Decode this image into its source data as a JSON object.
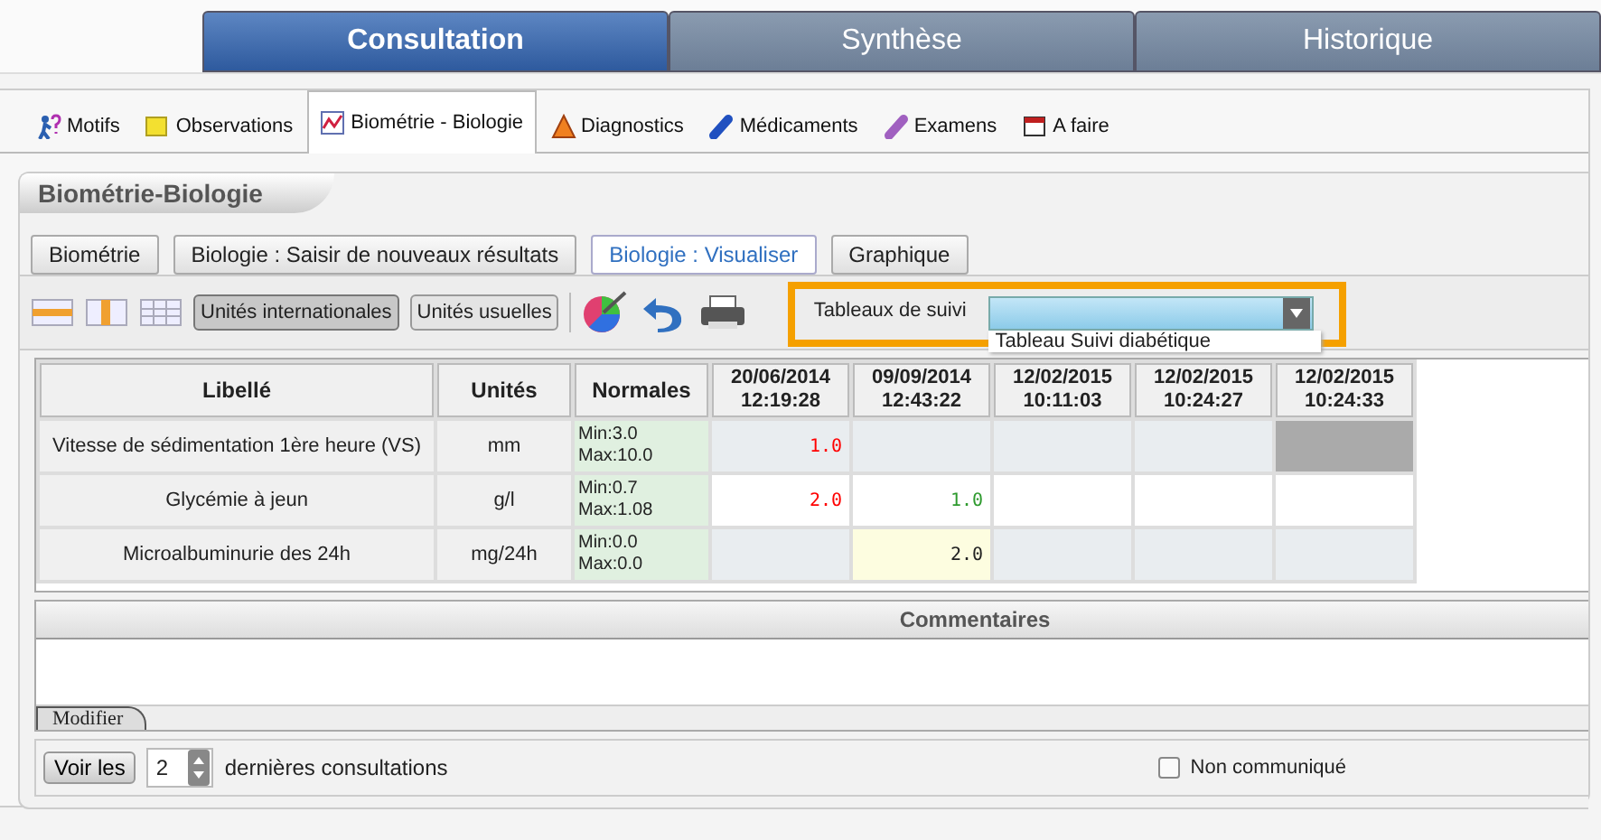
{
  "main_tabs": [
    {
      "label": "Consultation",
      "selected": true
    },
    {
      "label": "Synthèse",
      "selected": false
    },
    {
      "label": "Historique",
      "selected": false
    }
  ],
  "sub_tabs": [
    {
      "label": "Motifs",
      "kind": "walker",
      "selected": false
    },
    {
      "label": "Observations",
      "kind": "note",
      "selected": false
    },
    {
      "label": "Biométrie - Biologie",
      "kind": "chart",
      "selected": true
    },
    {
      "label": "Diagnostics",
      "kind": "warning",
      "selected": false
    },
    {
      "label": "Médicaments",
      "kind": "pill",
      "selected": false
    },
    {
      "label": "Examens",
      "kind": "capsule",
      "selected": false
    },
    {
      "label": "A faire",
      "kind": "calendar",
      "selected": false
    }
  ],
  "panel": {
    "title": "Biométrie-Biologie",
    "view_buttons": [
      {
        "label": "Biométrie",
        "selected": false
      },
      {
        "label": "Biologie : Saisir de nouveaux résultats",
        "selected": false
      },
      {
        "label": "Biologie : Visualiser",
        "selected": true
      },
      {
        "label": "Graphique",
        "selected": false
      }
    ],
    "unit_buttons": [
      {
        "label": "Unités internationales",
        "selected": true
      },
      {
        "label": "Unités usuelles",
        "selected": false
      }
    ],
    "tracking": {
      "label": "Tableaux de suivi",
      "options": [
        "Tableau Suivi diabétique"
      ]
    },
    "table": {
      "columns": [
        "Libellé",
        "Unités",
        "Normales"
      ],
      "date_columns": [
        {
          "date": "20/06/2014",
          "time": "12:19:28"
        },
        {
          "date": "09/09/2014",
          "time": "12:43:22"
        },
        {
          "date": "12/02/2015",
          "time": "10:11:03"
        },
        {
          "date": "12/02/2015",
          "time": "10:24:27"
        },
        {
          "date": "12/02/2015",
          "time": "10:24:33"
        }
      ],
      "rows": [
        {
          "label": "Vitesse de sédimentation 1ère heure (VS)",
          "unit": "mm",
          "min": "Min:3.0",
          "max": "Max:10.0",
          "cells": [
            {
              "kind": "plain",
              "value": "1.0",
              "color": "#ff0000"
            },
            {
              "kind": "plain"
            },
            {
              "kind": "plain"
            },
            {
              "kind": "plain"
            },
            {
              "kind": "locked"
            }
          ]
        },
        {
          "label": "Glycémie à jeun",
          "unit": "g/l",
          "min": "Min:0.7",
          "max": "Max:1.08",
          "cells": [
            {
              "kind": "entry",
              "value": "2.0",
              "color": "#ff0000"
            },
            {
              "kind": "entry",
              "value": "1.0",
              "color": "#2e9a2e"
            },
            {
              "kind": "entry"
            },
            {
              "kind": "entry"
            },
            {
              "kind": "entry"
            }
          ]
        },
        {
          "label": "Microalbuminurie des 24h",
          "unit": "mg/24h",
          "min": "Min:0.0",
          "max": "Max:0.0",
          "cells": [
            {
              "kind": "plain"
            },
            {
              "kind": "highlight",
              "value": "2.0",
              "color": "#222222"
            },
            {
              "kind": "plain"
            },
            {
              "kind": "plain"
            },
            {
              "kind": "plain"
            }
          ]
        }
      ]
    },
    "comments": {
      "title": "Commentaires",
      "edit_tab": "Modifier"
    },
    "footer": {
      "button": "Voir les",
      "count": "2",
      "suffix": "dernières consultations",
      "checkbox": {
        "label": "Non communiqué",
        "checked": false
      }
    }
  }
}
